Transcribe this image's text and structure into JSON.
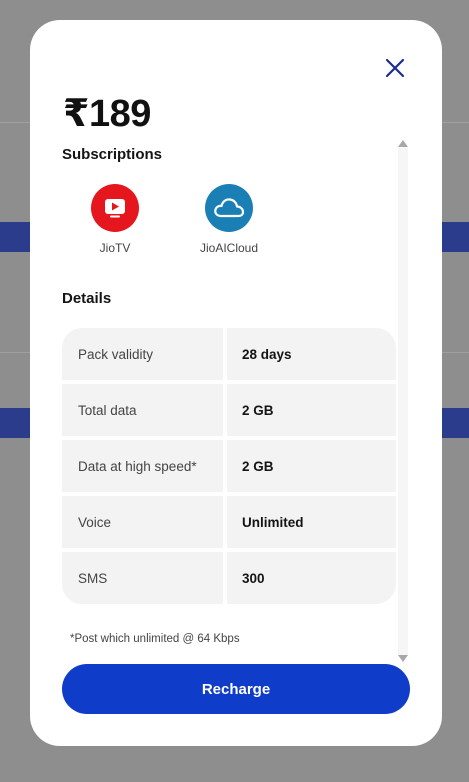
{
  "plan": {
    "price": "₹189"
  },
  "subscriptions": {
    "title": "Subscriptions",
    "items": [
      {
        "label": "JioTV",
        "icon": "jiotv-icon",
        "color": "#e5161d"
      },
      {
        "label": "JioAICloud",
        "icon": "cloud-icon",
        "color": "#1a7fb5"
      }
    ]
  },
  "details": {
    "title": "Details",
    "rows": [
      {
        "label": "Pack validity",
        "value": "28 days"
      },
      {
        "label": "Total data",
        "value": "2 GB"
      },
      {
        "label": "Data at high speed*",
        "value": "2 GB"
      },
      {
        "label": "Voice",
        "value": "Unlimited"
      },
      {
        "label": "SMS",
        "value": "300"
      }
    ],
    "footnote": "*Post which unlimited @ 64 Kbps"
  },
  "actions": {
    "recharge_label": "Recharge",
    "close_icon": "close-icon"
  },
  "colors": {
    "primary": "#0f3cc9",
    "close": "#1a2d8a",
    "overlay": "#8e8e8e"
  }
}
